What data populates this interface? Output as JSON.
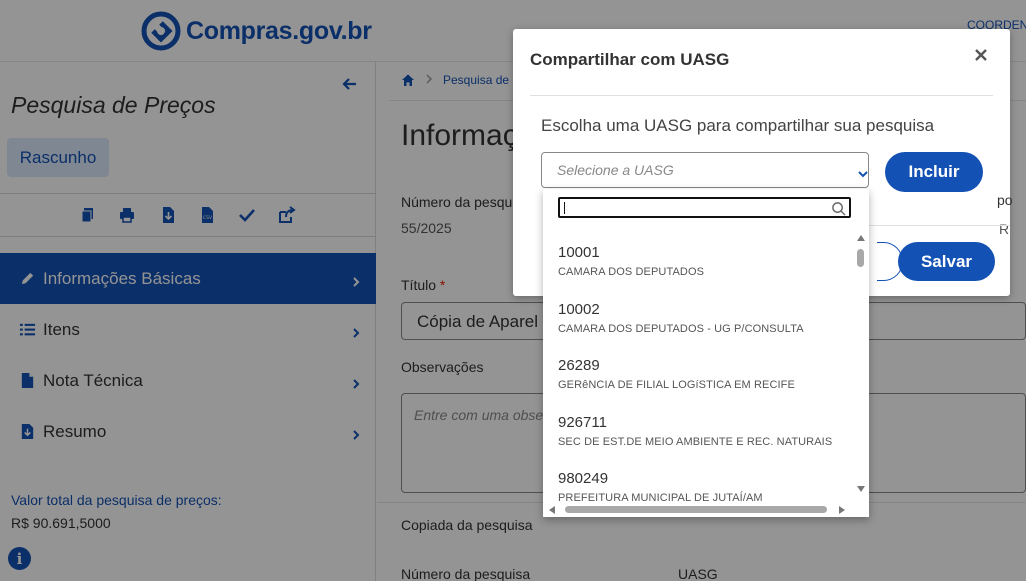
{
  "header": {
    "logo_text": "Compras",
    "logo_domain": ".gov.br",
    "right_text": "COORDEN"
  },
  "sidebar": {
    "title": "Pesquisa de Preços",
    "status_badge": "Rascunho",
    "toolbar_icons": [
      "copy-icon",
      "print-icon",
      "download-icon",
      "csv-icon",
      "check-icon",
      "share-icon"
    ],
    "items": [
      {
        "label": "Informações Básicas",
        "icon": "pencil-icon",
        "active": true
      },
      {
        "label": "Itens",
        "icon": "list-icon",
        "active": false
      },
      {
        "label": "Nota Técnica",
        "icon": "document-icon",
        "active": false
      },
      {
        "label": "Resumo",
        "icon": "document-download-icon",
        "active": false
      }
    ],
    "total_label": "Valor total da pesquisa de preços:",
    "total_value": "R$ 90.691,5000"
  },
  "main": {
    "breadcrumb": [
      "Pesquisa de"
    ],
    "title": "Informaç",
    "numero_label": "Número da pesqu",
    "numero_value": "55/2025",
    "titulo_label": "Título",
    "titulo_required": "*",
    "titulo_value": "Cópia de Aparel",
    "observacoes_label": "Observações",
    "observacoes_placeholder": "Entre com uma obse",
    "copiada_label": "Copiada da pesquisa",
    "numero2_label": "Número da pesquisa",
    "uasg_label": "UASG"
  },
  "modal": {
    "title": "Compartilhar com UASG",
    "close": "×",
    "subtitle": "Escolha uma UASG para compartilhar sua pesquisa",
    "select_placeholder": "Selecione a UASG",
    "include_button": "Incluir",
    "save_button": "Salvar",
    "peek_label": "po",
    "peek_value": "R"
  },
  "dropdown": {
    "search_value": "",
    "options": [
      {
        "code": "10001",
        "name": "CAMARA DOS DEPUTADOS"
      },
      {
        "code": "10002",
        "name": "CAMARA DOS DEPUTADOS - UG P/CONSULTA"
      },
      {
        "code": "26289",
        "name": "GERêNCIA DE FILIAL LOGíSTICA EM RECIFE"
      },
      {
        "code": "926711",
        "name": "SEC DE EST.DE MEIO AMBIENTE E REC. NATURAIS"
      },
      {
        "code": "980249",
        "name": "PREFEITURA MUNICIPAL DE JUTAÍ/AM"
      }
    ]
  },
  "colors": {
    "primary": "#1351b4",
    "active_nav": "#1351b4",
    "badge_bg": "#dbe8fb",
    "required": "#e52207"
  }
}
